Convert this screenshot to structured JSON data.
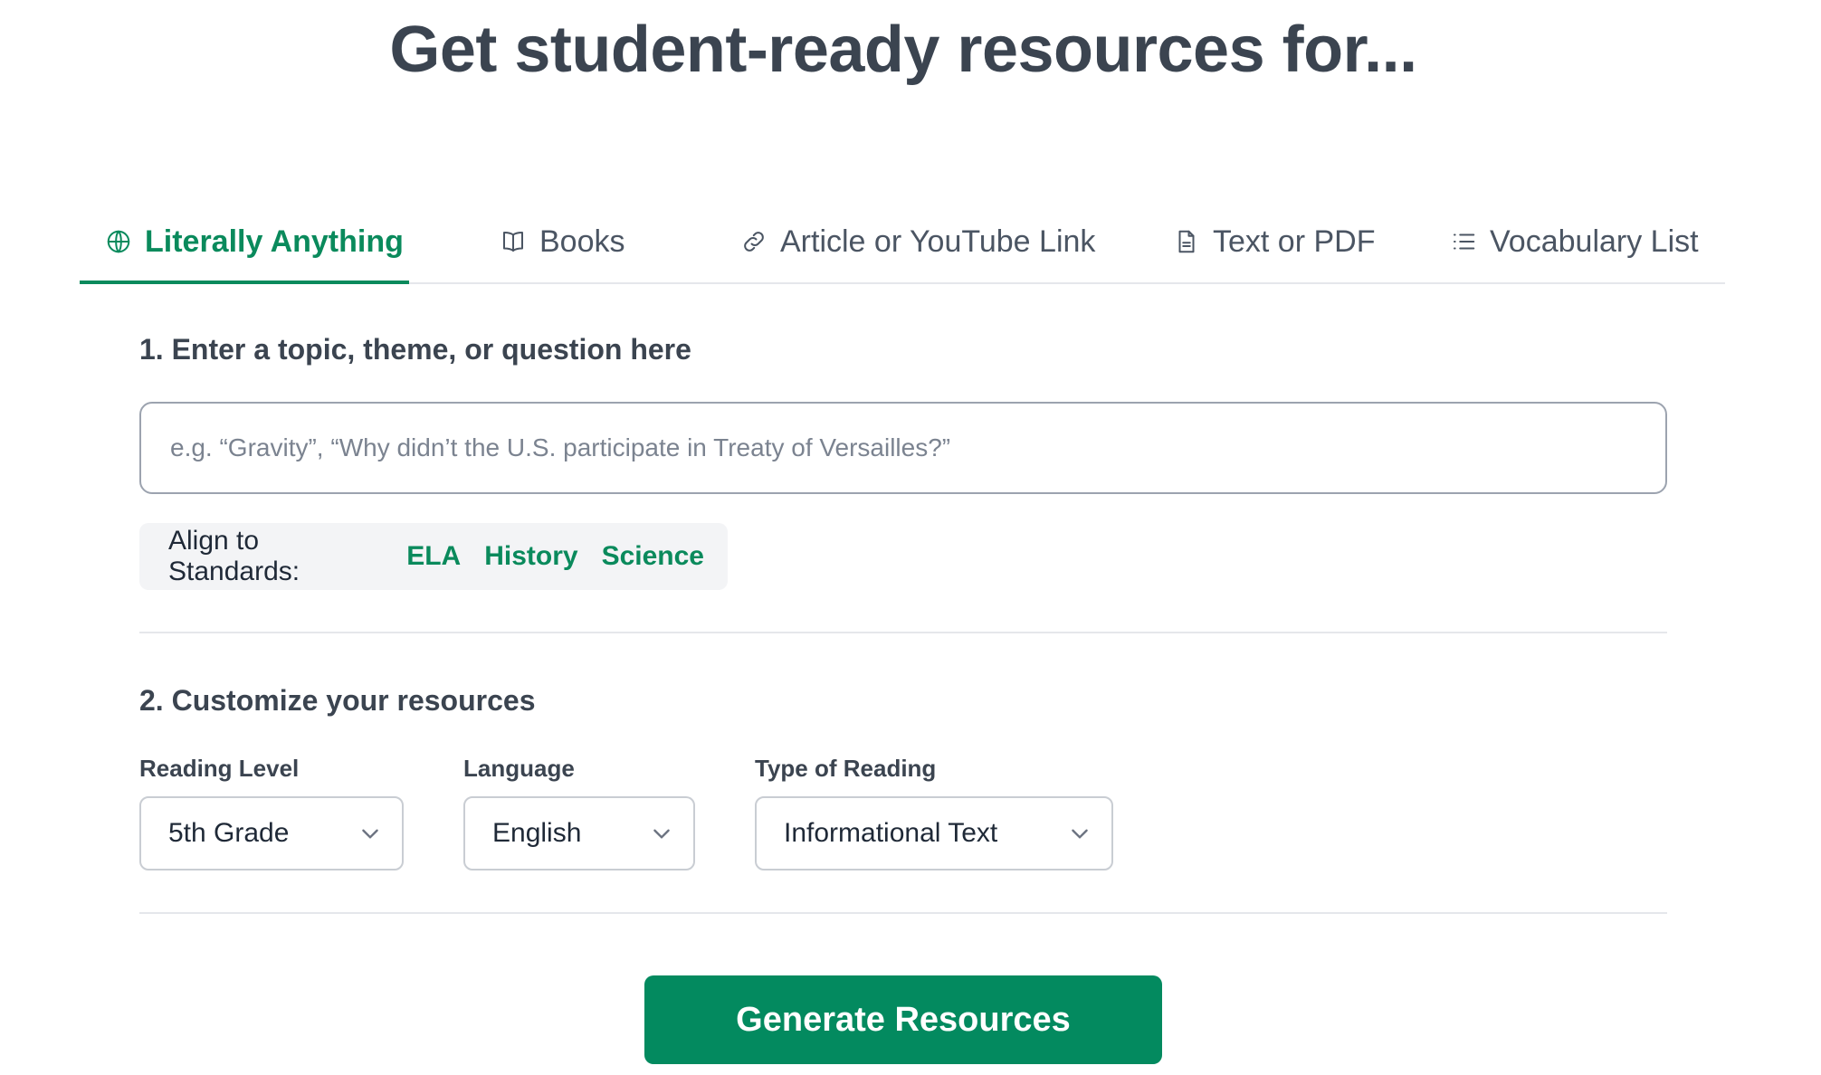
{
  "header": {
    "title": "Get student-ready resources for..."
  },
  "tabs": [
    {
      "label": "Literally Anything",
      "icon": "globe-icon",
      "active": true
    },
    {
      "label": "Books",
      "icon": "book-icon",
      "active": false
    },
    {
      "label": "Article or YouTube Link",
      "icon": "link-icon",
      "active": false
    },
    {
      "label": "Text or PDF",
      "icon": "document-icon",
      "active": false
    },
    {
      "label": "Vocabulary List",
      "icon": "list-icon",
      "active": false
    }
  ],
  "step1": {
    "title": "1. Enter a topic, theme, or question here",
    "input_value": "",
    "input_placeholder": "e.g. “Gravity”, “Why didn’t the U.S. participate in Treaty of Versailles?”",
    "standards_label": "Align to Standards:",
    "standards": [
      "ELA",
      "History",
      "Science"
    ]
  },
  "step2": {
    "title": "2. Customize your resources",
    "reading_level": {
      "label": "Reading Level",
      "value": "5th Grade"
    },
    "language": {
      "label": "Language",
      "value": "English"
    },
    "reading_type": {
      "label": "Type of Reading",
      "value": "Informational Text"
    }
  },
  "generate_button": {
    "label": "Generate Resources"
  },
  "colors": {
    "accent": "#0a8a5c",
    "button": "#038a5f",
    "text": "#3b4450"
  }
}
